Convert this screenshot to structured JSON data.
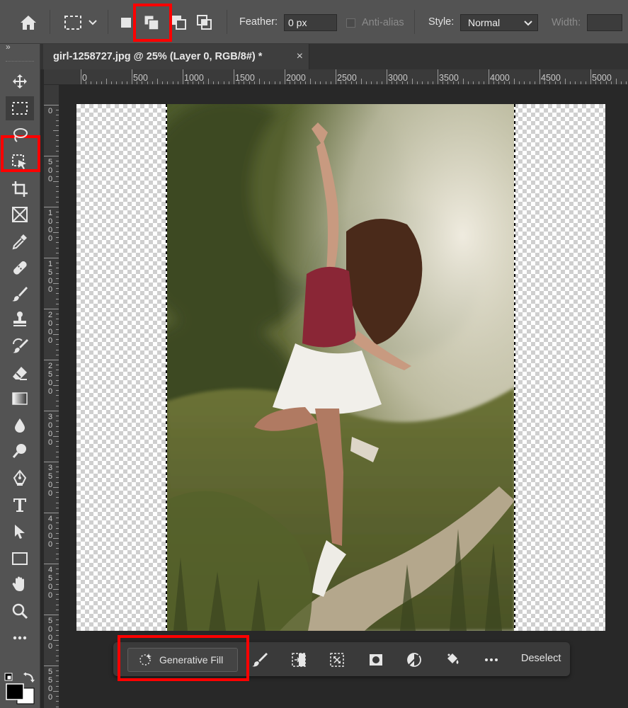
{
  "options_bar": {
    "feather_label": "Feather:",
    "feather_value": "0 px",
    "anti_alias_label": "Anti-alias",
    "style_label": "Style:",
    "style_value": "Normal",
    "width_label": "Width:",
    "active_selection_mode": "add-to-selection"
  },
  "toolbar": {
    "collapse_glyph": "»",
    "active_tool": "rectangular-marquee-tool"
  },
  "document_tab": {
    "title": "girl-1258727.jpg @ 25% (Layer 0, RGB/8#) *",
    "close_glyph": "×"
  },
  "rulers": {
    "horizontal": [
      "0",
      "500",
      "1000",
      "1500",
      "2000",
      "2500",
      "3000",
      "3500",
      "4000",
      "4500",
      "5000"
    ],
    "vertical": [
      "0",
      "500",
      "1000",
      "1500",
      "2000",
      "2500",
      "3000",
      "3500",
      "4000",
      "4500",
      "5000",
      "5500"
    ]
  },
  "task_bar": {
    "generative_fill_label": "Generative Fill",
    "deselect_label": "Deselect"
  },
  "colors": {
    "highlight": "#ff0000",
    "panel": "#535353",
    "canvas_bg": "#282828"
  }
}
